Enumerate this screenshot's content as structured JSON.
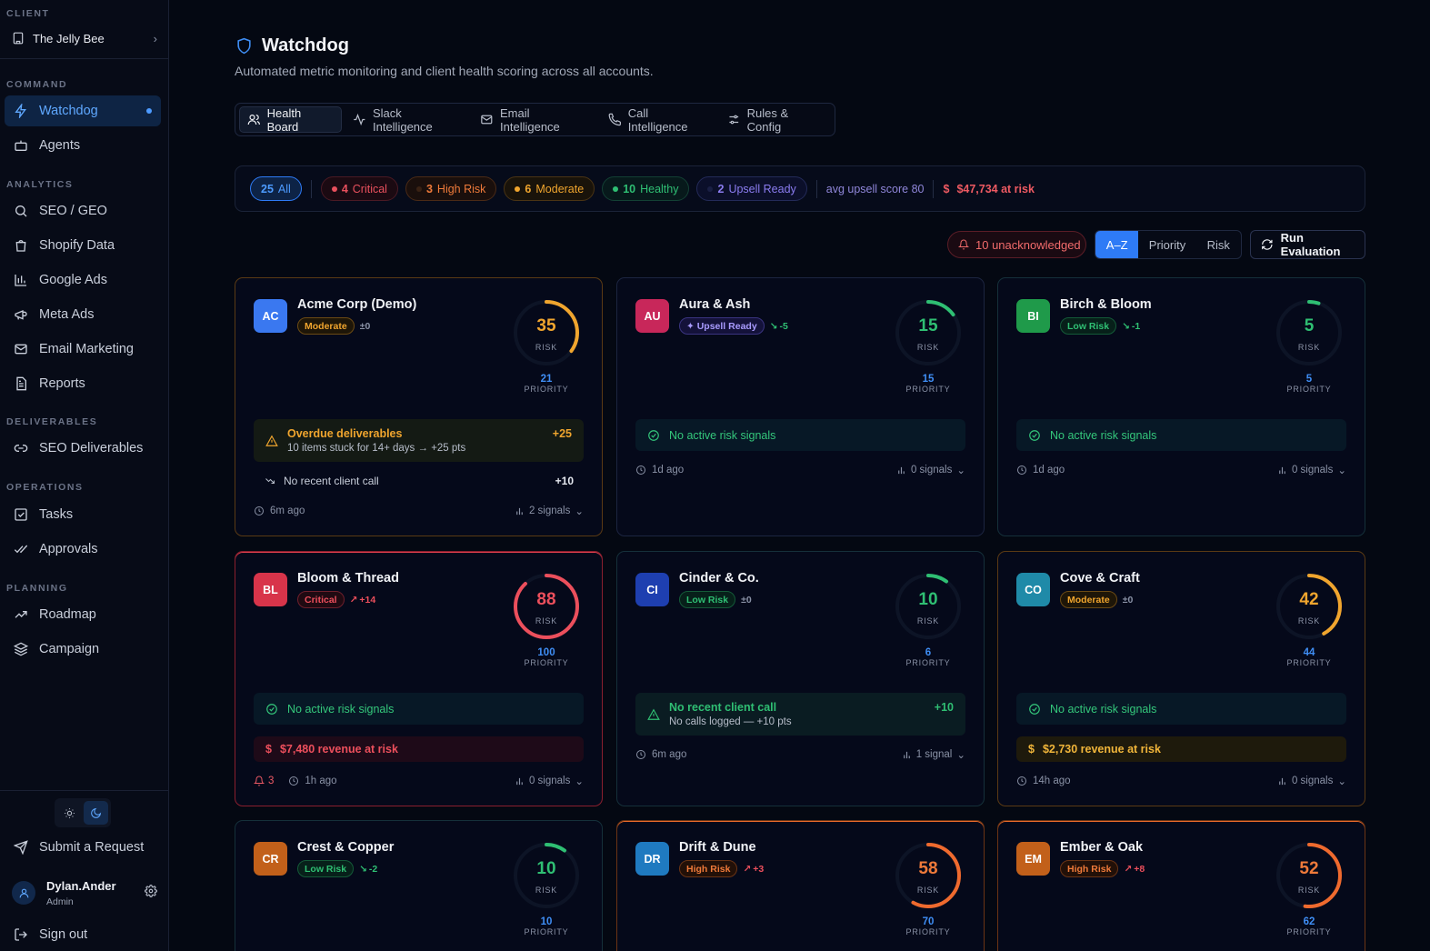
{
  "sidebar": {
    "client_label": "CLIENT",
    "client_name": "The Jelly Bee",
    "sections": {
      "command": "COMMAND",
      "analytics": "ANALYTICS",
      "deliverables": "DELIVERABLES",
      "operations": "OPERATIONS",
      "planning": "PLANNING"
    },
    "items": {
      "watchdog": "Watchdog",
      "agents": "Agents",
      "seo_geo": "SEO / GEO",
      "shopify": "Shopify Data",
      "google_ads": "Google Ads",
      "meta_ads": "Meta Ads",
      "email_marketing": "Email Marketing",
      "reports": "Reports",
      "seo_deliverables": "SEO Deliverables",
      "tasks": "Tasks",
      "approvals": "Approvals",
      "roadmap": "Roadmap",
      "campaign": "Campaign"
    },
    "submit_request": "Submit a Request",
    "user_name": "Dylan.Ander",
    "user_role": "Admin",
    "sign_out": "Sign out"
  },
  "header": {
    "title": "Watchdog",
    "subtitle": "Automated metric monitoring and client health scoring across all accounts."
  },
  "tabs": [
    "Health Board",
    "Slack Intelligence",
    "Email Intelligence",
    "Call Intelligence",
    "Rules & Config"
  ],
  "filters": {
    "all": {
      "count": "25",
      "label": "All"
    },
    "critical": {
      "count": "4",
      "label": "Critical"
    },
    "high_risk": {
      "count": "3",
      "label": "High Risk"
    },
    "moderate": {
      "count": "6",
      "label": "Moderate"
    },
    "healthy": {
      "count": "10",
      "label": "Healthy"
    },
    "upsell": {
      "count": "2",
      "label": "Upsell Ready"
    },
    "avg_upsell": "avg upsell score 80",
    "at_risk": "$47,734 at risk"
  },
  "controls": {
    "unacknowledged": "10 unacknowledged",
    "sort_options": [
      "A–Z",
      "Priority",
      "Risk"
    ],
    "sort_selected": "A–Z",
    "run_evaluation": "Run Evaluation"
  },
  "labels": {
    "risk": "RISK",
    "priority": "PRIORITY"
  },
  "cards": [
    {
      "initials": "AC",
      "name": "Acme Corp (Demo)",
      "tag": "Moderate",
      "delta": "±0",
      "risk": 35,
      "priority": "21",
      "signal_title": "Overdue deliverables",
      "signal_sub": "10 items stuck for 14+ days → +25 pts",
      "signal_pts": "+25",
      "extra_signal": "No recent client call",
      "extra_pts": "+10",
      "time": "6m ago",
      "signals": "2 signals"
    },
    {
      "initials": "AU",
      "name": "Aura & Ash",
      "tag": "✦ Upsell Ready",
      "delta": "-5",
      "risk": 15,
      "priority": "15",
      "signal_title": "No active risk signals",
      "time": "1d ago",
      "signals": "0 signals"
    },
    {
      "initials": "BI",
      "name": "Birch & Bloom",
      "tag": "Low Risk",
      "delta": "-1",
      "risk": 5,
      "priority": "5",
      "signal_title": "No active risk signals",
      "time": "1d ago",
      "signals": "0 signals"
    },
    {
      "initials": "BL",
      "name": "Bloom & Thread",
      "tag": "Critical",
      "delta": "+14",
      "risk": 88,
      "priority": "100",
      "signal_title": "No active risk signals",
      "revenue": "$7,480 revenue at risk",
      "bells": "3",
      "time": "1h ago",
      "signals": "0 signals"
    },
    {
      "initials": "CI",
      "name": "Cinder & Co.",
      "tag": "Low Risk",
      "delta": "±0",
      "risk": 10,
      "priority": "6",
      "signal_title": "No recent client call",
      "signal_sub": "No calls logged — +10 pts",
      "signal_pts": "+10",
      "time": "6m ago",
      "signals": "1 signal"
    },
    {
      "initials": "CO",
      "name": "Cove & Craft",
      "tag": "Moderate",
      "delta": "±0",
      "risk": 42,
      "priority": "44",
      "signal_title": "No active risk signals",
      "revenue": "$2,730 revenue at risk",
      "time": "14h ago",
      "signals": "0 signals"
    },
    {
      "initials": "CR",
      "name": "Crest & Copper",
      "tag": "Low Risk",
      "delta": "-2",
      "risk": 10,
      "priority": "10"
    },
    {
      "initials": "DR",
      "name": "Drift & Dune",
      "tag": "High Risk",
      "delta": "+3",
      "risk": 58,
      "priority": "70"
    },
    {
      "initials": "EM",
      "name": "Ember & Oak",
      "tag": "High Risk",
      "delta": "+8",
      "risk": 52,
      "priority": "62"
    }
  ],
  "colors": {
    "moderate": "#f0a52e",
    "critical": "#ec4f5c",
    "high_risk": "#ef6a2e",
    "low_risk": "#2fbf73",
    "upsell": "#8b7cf0",
    "priority": "#3f8ef5",
    "accent": "#2e7bf6"
  }
}
